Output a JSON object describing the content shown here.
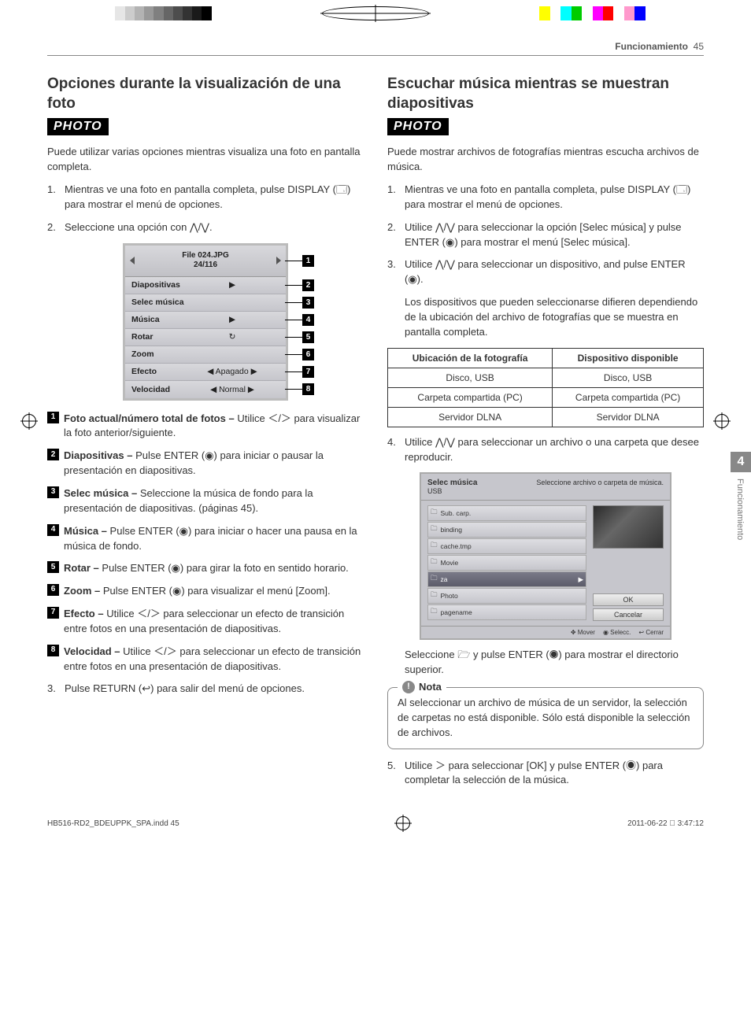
{
  "header": {
    "section": "Funcionamiento",
    "page": "45"
  },
  "sidetab": {
    "num": "4",
    "label": "Funcionamiento"
  },
  "left": {
    "h2": "Opciones durante la visualización de una foto",
    "tag": "PHOTO",
    "intro": "Puede utilizar varias opciones mientras visualiza una foto en pantalla completa.",
    "step1": "Mientras ve una foto en pantalla completa, pulse DISPLAY (🗔) para mostrar el menú de opciones.",
    "step2": "Seleccione una opción con ⋀/⋁.",
    "osd": {
      "file": "File 024.JPG",
      "count": "24/116",
      "rows": [
        {
          "label": "Diapositivas",
          "val": "▶"
        },
        {
          "label": "Selec música",
          "val": ""
        },
        {
          "label": "Música",
          "val": "▶"
        },
        {
          "label": "Rotar",
          "val": "↻"
        },
        {
          "label": "Zoom",
          "val": ""
        },
        {
          "label": "Efecto",
          "val": "◀  Apagado  ▶"
        },
        {
          "label": "Velocidad",
          "val": "◀  Normal  ▶"
        }
      ]
    },
    "callouts": [
      "1",
      "2",
      "3",
      "4",
      "5",
      "6",
      "7",
      "8"
    ],
    "desc": [
      {
        "n": "1",
        "b": "Foto actual/número total de fotos –",
        "t": "Utilice ＜/＞ para visualizar la foto anterior/siguiente."
      },
      {
        "n": "2",
        "b": "Diapositivas –",
        "t": "Pulse ENTER (◉) para iniciar o pausar la presentación en diapositivas."
      },
      {
        "n": "3",
        "b": "Selec música –",
        "t": "Seleccione la música de fondo para la presentación de diapositivas. (páginas 45)."
      },
      {
        "n": "4",
        "b": "Música –",
        "t": "Pulse ENTER (◉) para iniciar o hacer una pausa en la música de fondo."
      },
      {
        "n": "5",
        "b": "Rotar –",
        "t": "Pulse ENTER (◉) para girar la foto en sentido horario."
      },
      {
        "n": "6",
        "b": "Zoom –",
        "t": "Pulse ENTER (◉) para visualizar el menú [Zoom]."
      },
      {
        "n": "7",
        "b": "Efecto –",
        "t": "Utilice ＜/＞ para seleccionar un efecto de transición entre fotos en una presentación de diapositivas."
      },
      {
        "n": "8",
        "b": "Velocidad –",
        "t": "Utilice ＜/＞ para seleccionar un efecto de transición entre fotos en una presentación de diapositivas."
      }
    ],
    "step3": "Pulse RETURN (↩) para salir del menú de opciones."
  },
  "right": {
    "h2": "Escuchar música mientras se muestran diapositivas",
    "tag": "PHOTO",
    "intro": "Puede mostrar archivos de fotografías mientras escucha archivos de música.",
    "step1": "Mientras ve una foto en pantalla completa, pulse DISPLAY (🗔) para mostrar el menú de opciones.",
    "step2": "Utilice ⋀/⋁ para seleccionar la opción [Selec música] y pulse ENTER (◉) para mostrar el menú [Selec música].",
    "step3": "Utilice ⋀/⋁ para seleccionar un dispositivo, and pulse ENTER (◉).",
    "step3b": "Los dispositivos que pueden seleccionarse difieren dependiendo de la ubicación del archivo de fotografías que se muestra en pantalla completa.",
    "table": {
      "h1": "Ubicación de la fotografía",
      "h2": "Dispositivo disponible",
      "rows": [
        [
          "Disco, USB",
          "Disco, USB"
        ],
        [
          "Carpeta compartida (PC)",
          "Carpeta compartida (PC)"
        ],
        [
          "Servidor DLNA",
          "Servidor DLNA"
        ]
      ]
    },
    "step4": "Utilice ⋀/⋁ para seleccionar un archivo o una carpeta que desee reproducir.",
    "fb": {
      "title": "Selec música",
      "sub": "USB",
      "hint": "Seleccione archivo o carpeta de música.",
      "items": [
        "Sub. carp.",
        "binding",
        "cache.tmp",
        "Movie",
        "za",
        "Photo",
        "pagename"
      ],
      "ok": "OK",
      "cancel": "Cancelar",
      "foot": [
        "✥ Mover",
        "◉ Selecc.",
        "↩ Cerrar"
      ]
    },
    "afterfb": "Seleccione 🗁 y pulse ENTER (◉) para mostrar el directorio superior.",
    "note_title": "Nota",
    "note": "Al seleccionar un archivo de música de un servidor, la selección de carpetas no está disponible. Sólo está disponible la selección de archivos.",
    "step5": "Utilice ＞ para seleccionar [OK] y pulse ENTER (◉) para completar la selección de la música."
  },
  "footer": {
    "file": "HB516-RD2_BDEUPPK_SPA.indd   45",
    "date": " 2011-06-22   󰀀 3:47:12"
  }
}
